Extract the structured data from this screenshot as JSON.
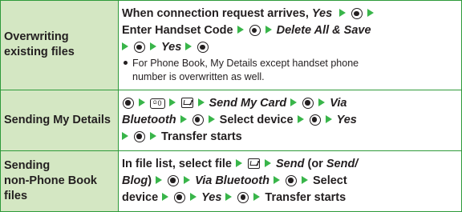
{
  "rows": [
    {
      "label": "Overwriting existing files",
      "steps": {
        "p1": "When connection request arrives,",
        "yes1": "Yes",
        "enter_code": "Enter Handset Code",
        "delete_all_save": "Delete All & Save",
        "yes2": "Yes",
        "note_line1": "For Phone Book, My Details except handset phone",
        "note_line2": "number is overwritten as well."
      }
    },
    {
      "label": "Sending My Details",
      "steps": {
        "zero_key": "0",
        "zero_key_sub": "Ω",
        "send_my_card": "Send My Card",
        "via": "Via",
        "bluetooth": "Bluetooth",
        "select_device": "Select device",
        "yes": "Yes",
        "transfer": "Transfer starts"
      }
    },
    {
      "label_line1": "Sending",
      "label_line2": "non-Phone Book",
      "label_line3": "files",
      "steps": {
        "in_file_list": "In file list, select file",
        "send": "Send",
        "or_text": "(or",
        "send_blog_1": "Send/",
        "send_blog_2": "Blog",
        "close_paren": ")",
        "via_bluetooth": "Via Bluetooth",
        "select": "Select",
        "device": "device",
        "yes": "Yes",
        "transfer": "Transfer starts"
      }
    }
  ],
  "colors": {
    "border": "#2e9a3a",
    "label_bg": "#d4e7c3",
    "arrow": "#39b54a",
    "text": "#231f20"
  },
  "icons": {
    "arrow": "green-right-triangle-arrow",
    "center_key": "center-select-key-icon",
    "mail_key": "mail-key-icon",
    "zero_key": "zero-key-icon"
  }
}
